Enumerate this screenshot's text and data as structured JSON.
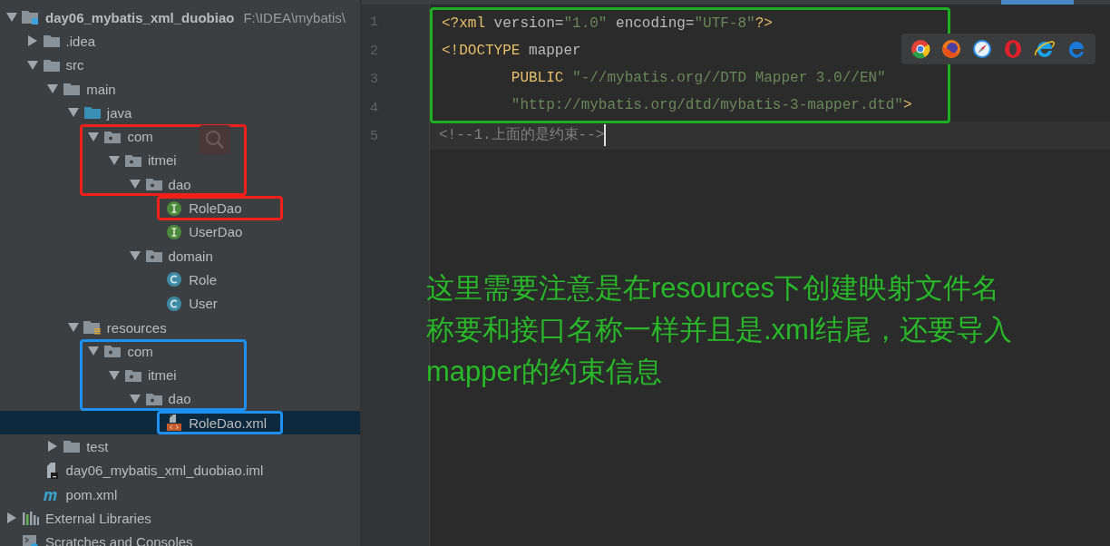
{
  "project_tree": {
    "items": [
      {
        "label": "day06_mybatis_xml_duobiao",
        "path": "F:\\IDEA\\mybatis\\",
        "kind": "project",
        "expanded": true,
        "selected": false,
        "children": [
          {
            "label": ".idea",
            "kind": "folder",
            "expanded": false,
            "selected": false
          },
          {
            "label": "src",
            "kind": "folder",
            "expanded": true,
            "selected": false,
            "children": [
              {
                "label": "main",
                "kind": "folder",
                "expanded": true,
                "selected": false,
                "children": [
                  {
                    "label": "java",
                    "kind": "source-folder",
                    "expanded": true,
                    "selected": false,
                    "children": [
                      {
                        "label": "com",
                        "kind": "package",
                        "expanded": true,
                        "selected": false,
                        "color": "#f0201a",
                        "children": [
                          {
                            "label": "itmei",
                            "kind": "package",
                            "expanded": true,
                            "selected": false,
                            "children": [
                              {
                                "label": "dao",
                                "kind": "package",
                                "expanded": true,
                                "selected": false,
                                "children": [
                                  {
                                    "label": "RoleDao",
                                    "kind": "interface",
                                    "selected": false,
                                    "color": "#f0201a"
                                  },
                                  {
                                    "label": "UserDao",
                                    "kind": "interface",
                                    "selected": false
                                  }
                                ]
                              },
                              {
                                "label": "domain",
                                "kind": "package",
                                "expanded": true,
                                "selected": false,
                                "children": [
                                  {
                                    "label": "Role",
                                    "kind": "class",
                                    "selected": false
                                  },
                                  {
                                    "label": "User",
                                    "kind": "class",
                                    "selected": false
                                  }
                                ]
                              }
                            ]
                          }
                        ]
                      }
                    ]
                  },
                  {
                    "label": "resources",
                    "kind": "resource-folder",
                    "expanded": true,
                    "selected": false,
                    "children": [
                      {
                        "label": "com",
                        "kind": "package",
                        "expanded": true,
                        "selected": false,
                        "color": "#1e90ef",
                        "children": [
                          {
                            "label": "itmei",
                            "kind": "package",
                            "expanded": true,
                            "selected": false,
                            "children": [
                              {
                                "label": "dao",
                                "kind": "package",
                                "expanded": true,
                                "selected": false,
                                "children": [
                                  {
                                    "label": "RoleDao.xml",
                                    "kind": "xml",
                                    "selected": true,
                                    "color": "#1e90ef"
                                  }
                                ]
                              }
                            ]
                          }
                        ]
                      }
                    ]
                  }
                ]
              },
              {
                "label": "test",
                "kind": "folder",
                "expanded": false,
                "selected": false
              }
            ]
          },
          {
            "label": "day06_mybatis_xml_duobiao.iml",
            "kind": "iml",
            "selected": false
          },
          {
            "label": "pom.xml",
            "kind": "maven",
            "selected": false
          }
        ]
      },
      {
        "label": "External Libraries",
        "kind": "libraries",
        "expanded": false,
        "selected": false
      },
      {
        "label": "Scratches and Consoles",
        "kind": "scratches",
        "selected": false
      }
    ]
  },
  "editor": {
    "highlight_block": {
      "color": "#1fae1f",
      "lines": [
        {
          "number": "1",
          "current": false,
          "tokens": [
            {
              "kind": "tag",
              "text": "<?xml "
            },
            {
              "kind": "attr",
              "text": "version="
            },
            {
              "kind": "string",
              "text": "\"1.0\""
            },
            {
              "kind": "attr",
              "text": " encoding="
            },
            {
              "kind": "string",
              "text": "\"UTF-8\""
            },
            {
              "kind": "tag",
              "text": "?>"
            }
          ]
        },
        {
          "number": "2",
          "current": false,
          "tokens": [
            {
              "kind": "tag",
              "text": "<"
            },
            {
              "kind": "keyword",
              "text": "!DOCTYPE"
            },
            {
              "kind": "attr",
              "text": " mapper"
            }
          ]
        },
        {
          "number": "3",
          "current": false,
          "tokens": [
            {
              "kind": "keyword",
              "text": "        PUBLIC"
            },
            {
              "kind": "string",
              "text": " \"-//mybatis.org//DTD Mapper 3.0//EN\""
            }
          ]
        },
        {
          "number": "4",
          "current": false,
          "tokens": [
            {
              "kind": "string",
              "text": "        \"http://mybatis.org/dtd/mybatis-3-mapper.dtd\""
            },
            {
              "kind": "tag",
              "text": ">"
            }
          ]
        }
      ]
    },
    "lines": [
      {
        "number": "5",
        "current": true,
        "tokens": [
          {
            "kind": "comment",
            "text": "<!--1.上面的是约束-->"
          }
        ]
      }
    ],
    "browser_icons": [
      {
        "kind": "chrome"
      },
      {
        "kind": "firefox"
      },
      {
        "kind": "safari"
      },
      {
        "kind": "opera"
      },
      {
        "kind": "ie"
      },
      {
        "kind": "edge"
      }
    ]
  },
  "note": "这里需要注意是在resources下创建映射文件名称要和接口名称一样并且是.xml结尾，还要导入mapper的约束信息"
}
